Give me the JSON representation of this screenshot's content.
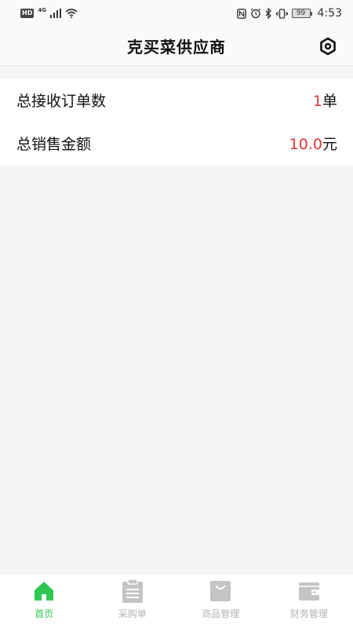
{
  "status_bar": {
    "hd_badge": "HD",
    "network": "4G",
    "battery": "99",
    "time": "4:53"
  },
  "header": {
    "title": "克买菜供应商",
    "settings_icon": "settings-icon"
  },
  "stats": [
    {
      "label": "总接收订单数",
      "value": "1",
      "unit": "单"
    },
    {
      "label": "总销售金额",
      "value": "10.0",
      "unit": "元"
    }
  ],
  "tabs": [
    {
      "label": "首页",
      "icon": "home-icon",
      "active": true
    },
    {
      "label": "采购单",
      "icon": "clipboard-icon",
      "active": false
    },
    {
      "label": "商品管理",
      "icon": "shopping-bag-icon",
      "active": false
    },
    {
      "label": "财务管理",
      "icon": "wallet-icon",
      "active": false
    }
  ],
  "colors": {
    "accent_green": "#2fc651",
    "value_red": "#e3353c",
    "inactive_gray": "#b3b3b3",
    "background": "#f5f5f5"
  }
}
